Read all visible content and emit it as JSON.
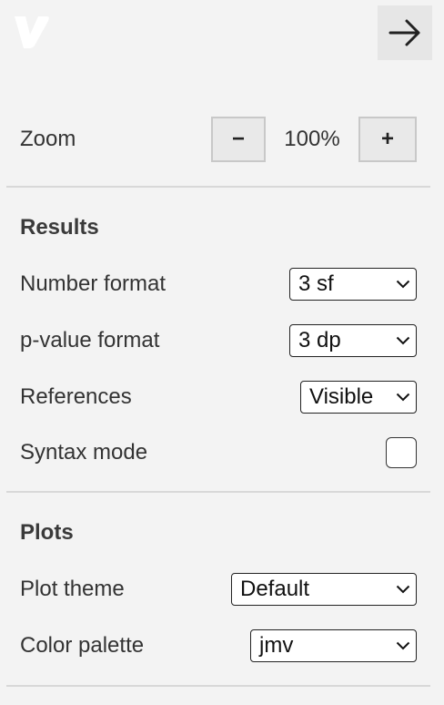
{
  "header": {
    "logo_icon": "jamovi-v-logo",
    "collapse_icon": "arrow-right-icon"
  },
  "zoom": {
    "label": "Zoom",
    "decrease_label": "−",
    "value": "100%",
    "increase_label": "+"
  },
  "results": {
    "title": "Results",
    "number_format": {
      "label": "Number format",
      "value": "3 sf"
    },
    "pvalue_format": {
      "label": "p-value format",
      "value": "3 dp"
    },
    "references": {
      "label": "References",
      "value": "Visible"
    },
    "syntax_mode": {
      "label": "Syntax mode",
      "checked": false
    }
  },
  "plots": {
    "title": "Plots",
    "plot_theme": {
      "label": "Plot theme",
      "value": "Default"
    },
    "color_palette": {
      "label": "Color palette",
      "value": "jmv"
    }
  }
}
